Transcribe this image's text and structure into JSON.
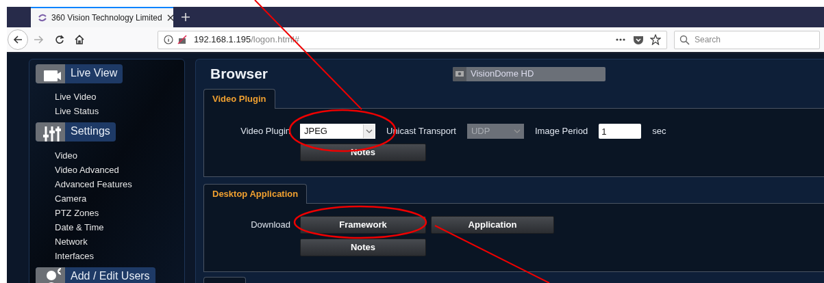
{
  "browser": {
    "tab_title": "360 Vision Technology Limited",
    "url_host": "192.168.1.195",
    "url_path": "/logon.html#",
    "search": {
      "placeholder": "Search"
    }
  },
  "sidebar": [
    {
      "kind": "camera",
      "title": "Live View",
      "items": [
        "Live Video",
        "Live Status"
      ]
    },
    {
      "kind": "sliders",
      "title": "Settings",
      "items": [
        "Video",
        "Video Advanced",
        "Advanced Features",
        "Camera",
        "PTZ Zones",
        "Date & Time",
        "Network",
        "Interfaces"
      ]
    },
    {
      "kind": "user",
      "title": "Add / Edit Users"
    }
  ],
  "main": {
    "title": "Browser",
    "device": "VisionDome HD",
    "sections": [
      {
        "tab": "Video Plugin",
        "rows": [
          {
            "label": "Video Plugin",
            "controls": [
              {
                "kind": "select",
                "value": "JPEG",
                "disabled": false
              },
              {
                "kind": "text",
                "text": "Unicast Transport"
              },
              {
                "kind": "select",
                "value": "UDP",
                "disabled": true
              },
              {
                "kind": "text",
                "text": "Image Period"
              },
              {
                "kind": "input",
                "value": "1"
              },
              {
                "kind": "text",
                "text": "sec"
              }
            ]
          },
          {
            "controls": [
              {
                "kind": "button",
                "text": "Notes"
              }
            ]
          }
        ]
      },
      {
        "tab": "Desktop Application",
        "rows": [
          {
            "label": "Download",
            "controls": [
              {
                "kind": "button",
                "text": "Framework"
              },
              {
                "kind": "button",
                "text": "Application"
              }
            ]
          },
          {
            "controls": [
              {
                "kind": "button",
                "text": "Notes"
              }
            ]
          }
        ]
      }
    ]
  }
}
